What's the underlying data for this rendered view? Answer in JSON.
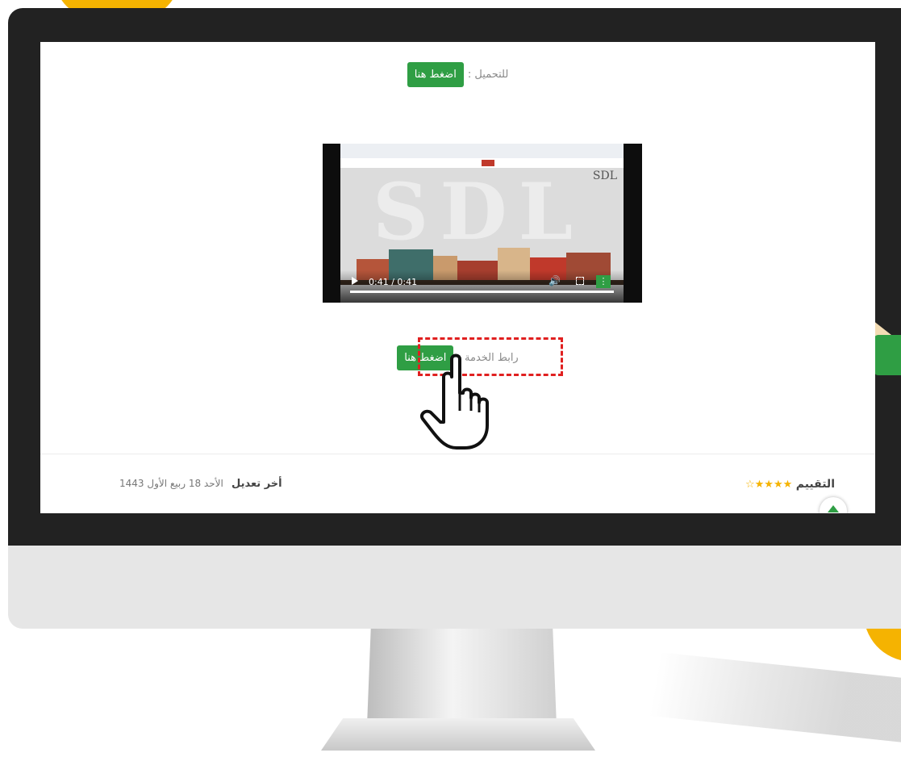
{
  "download_row": {
    "label": "للتحميل :",
    "button": "اضغط هنا"
  },
  "video": {
    "logo": "SDL",
    "time": "0:41 / 0:41",
    "progress": 1.0
  },
  "service_row": {
    "label": "رابط الخدمة :",
    "button": "اضغط هنا"
  },
  "footer": {
    "rating_label": "التقييم",
    "stars": "★★★★☆",
    "rating_value": 4,
    "last_edit_label": "أخر تعديل",
    "last_edit_value": "الأحد 18 ربيع الأول 1443"
  },
  "colors": {
    "accent_green": "#2f9e44",
    "highlight_red": "#e02020",
    "yellow": "#f5b301"
  },
  "icons": [
    "play-icon",
    "volume-icon",
    "fullscreen-icon",
    "more-icon",
    "hand-pointer-icon",
    "arrow-up-icon",
    "star-icon"
  ]
}
